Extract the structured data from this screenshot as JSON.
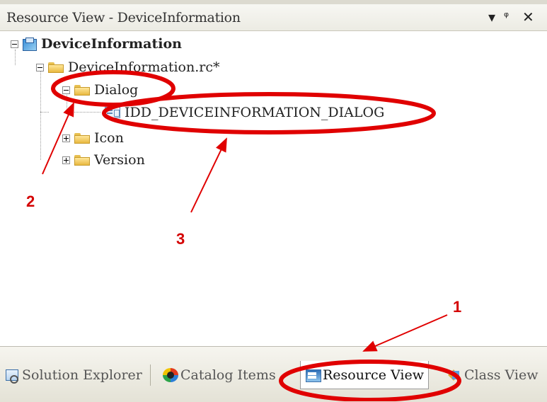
{
  "window": {
    "title": "Resource View - DeviceInformation",
    "dropdown_icon": "dropdown-arrow-icon",
    "pin_icon": "pin-icon",
    "close_icon": "close-icon"
  },
  "tree": {
    "project": "DeviceInformation",
    "rc_file": "DeviceInformation.rc*",
    "folders": [
      {
        "label": "Dialog",
        "expanded": true,
        "children": [
          "IDD_DEVICEINFORMATION_DIALOG"
        ]
      },
      {
        "label": "Icon",
        "expanded": false
      },
      {
        "label": "Version",
        "expanded": false
      }
    ]
  },
  "tabs": [
    {
      "label": "Solution Explorer",
      "icon": "solution-explorer-icon",
      "active": false
    },
    {
      "label": "Catalog Items",
      "icon": "catalog-items-icon",
      "active": false
    },
    {
      "label": "Resource View",
      "icon": "resource-view-icon",
      "active": true
    },
    {
      "label": "Class View",
      "icon": "class-view-icon",
      "active": false
    }
  ],
  "annotations": [
    "1",
    "2",
    "3"
  ],
  "colors": {
    "annotation": "#e00000",
    "folder": "#f3cd63"
  }
}
